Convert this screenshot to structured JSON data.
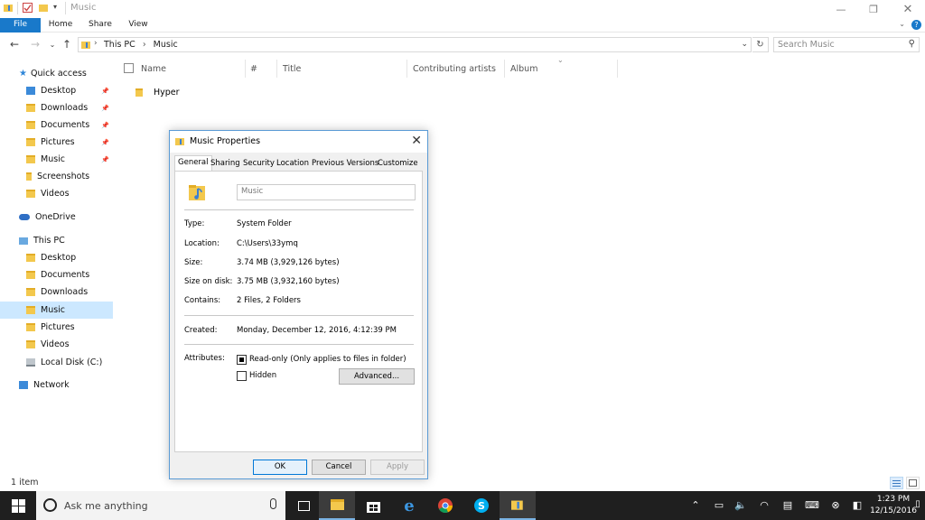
{
  "window": {
    "title": "Music",
    "quick_access_menu_icon": "qat-dropdown-icon"
  },
  "ribbon": {
    "tabs": [
      "File",
      "Home",
      "Share",
      "View"
    ],
    "help_label": "?"
  },
  "address": {
    "crumbs": [
      "This PC",
      "Music"
    ],
    "search_placeholder": "Search Music"
  },
  "nav": {
    "quick_access": "Quick access",
    "quick_items": [
      "Desktop",
      "Downloads",
      "Documents",
      "Pictures",
      "Music",
      "Screenshots",
      "Videos"
    ],
    "onedrive": "OneDrive",
    "this_pc": "This PC",
    "pc_items": [
      "Desktop",
      "Documents",
      "Downloads",
      "Music",
      "Pictures",
      "Videos",
      "Local Disk (C:)"
    ],
    "network": "Network"
  },
  "content": {
    "columns": [
      "Name",
      "#",
      "Title",
      "Contributing artists",
      "Album"
    ],
    "files": [
      {
        "name": "Hyper",
        "type": "folder"
      }
    ]
  },
  "status": {
    "count": "1 item"
  },
  "dialog": {
    "title": "Music Properties",
    "tabs": [
      "General",
      "Sharing",
      "Security",
      "Location",
      "Previous Versions",
      "Customize"
    ],
    "active_tab": "General",
    "name_value": "Music",
    "props": {
      "type_label": "Type:",
      "type_value": "System Folder",
      "location_label": "Location:",
      "location_value": "C:\\Users\\33ymq",
      "size_label": "Size:",
      "size_value": "3.74 MB (3,929,126 bytes)",
      "disk_label": "Size on disk:",
      "disk_value": "3.75 MB (3,932,160 bytes)",
      "contains_label": "Contains:",
      "contains_value": "2 Files, 2 Folders",
      "created_label": "Created:",
      "created_value": "Monday, December 12, 2016, 4:12:39 PM",
      "attributes_label": "Attributes:"
    },
    "readonly_label": "Read-only (Only applies to files in folder)",
    "readonly_checked": true,
    "hidden_label": "Hidden",
    "hidden_checked": false,
    "advanced_label": "Advanced...",
    "ok_label": "OK",
    "cancel_label": "Cancel",
    "apply_label": "Apply"
  },
  "taskbar": {
    "search_placeholder": "Ask me anything",
    "time": "1:23 PM",
    "date": "12/15/2016"
  },
  "colors": {
    "accent": "#1979ca",
    "selection": "#cce8ff",
    "taskbar": "#1f1f1f"
  }
}
